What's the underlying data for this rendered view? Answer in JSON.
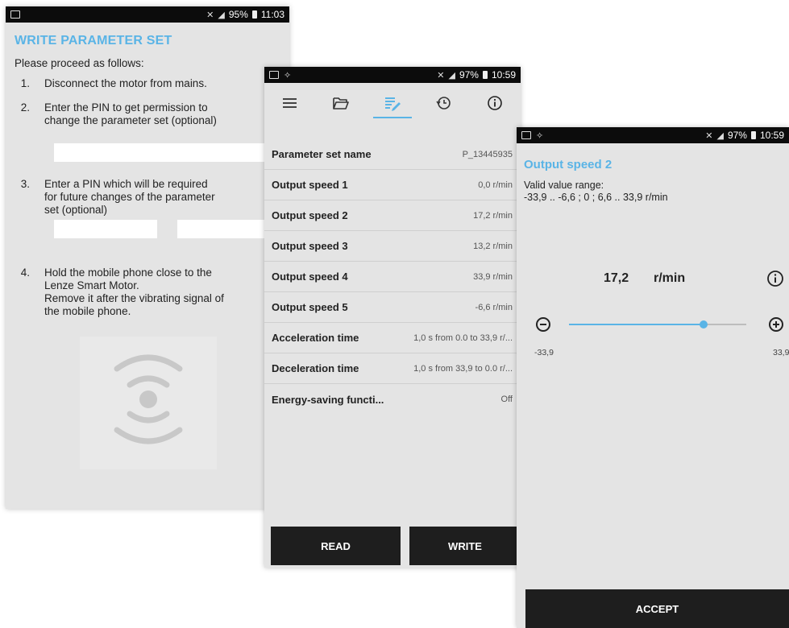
{
  "status1": {
    "battery": "95%",
    "time": "11:03"
  },
  "status2": {
    "battery": "97%",
    "time": "10:59"
  },
  "status3": {
    "battery": "97%",
    "time": "10:59"
  },
  "write_screen": {
    "title": "WRITE PARAMETER SET",
    "intro": "Please proceed as follows:",
    "steps": [
      {
        "num": "1.",
        "text": "Disconnect the motor from mains."
      },
      {
        "num": "2.",
        "text": "Enter the PIN to get permission to\nchange the parameter set (optional)"
      },
      {
        "num": "3.",
        "text": "Enter a PIN which will be required\nfor future changes of the parameter\nset (optional)"
      },
      {
        "num": "4.",
        "text": "Hold the mobile phone close to the\nLenze Smart Motor.\nRemove it after the vibrating signal of\nthe mobile phone."
      }
    ]
  },
  "params_screen": {
    "tabs": [
      "menu-icon",
      "folder-icon",
      "edit-list-icon",
      "history-icon",
      "info-icon"
    ],
    "rows": [
      {
        "name": "Parameter set name",
        "value": "P_13445935"
      },
      {
        "name": "Output speed 1",
        "value": "0,0 r/min"
      },
      {
        "name": "Output speed 2",
        "value": "17,2 r/min"
      },
      {
        "name": "Output speed 3",
        "value": "13,2 r/min"
      },
      {
        "name": "Output speed 4",
        "value": "33,9 r/min"
      },
      {
        "name": "Output speed 5",
        "value": "-6,6 r/min"
      },
      {
        "name": "Acceleration time",
        "value": "1,0 s from 0.0 to 33,9 r/..."
      },
      {
        "name": "Deceleration time",
        "value": "1,0 s from 33,9 to 0.0 r/..."
      },
      {
        "name": "Energy-saving functi...",
        "value": "Off"
      }
    ],
    "read_label": "READ",
    "write_label": "WRITE"
  },
  "speed_screen": {
    "title": "Output speed 2",
    "range_label": "Valid value range:",
    "range": "-33,9 .. -6,6 ; 0 ; 6,6 .. 33,9 r/min",
    "value": "17,2",
    "unit": "r/min",
    "min_label": "-33,9",
    "max_label": "33,9",
    "slider_fraction": 0.76,
    "accept_label": "ACCEPT"
  },
  "colors": {
    "accent": "#5ab4e6",
    "button": "#1e1e1e",
    "statusbar": "#0c0c0c",
    "screen": "#e4e4e4"
  }
}
